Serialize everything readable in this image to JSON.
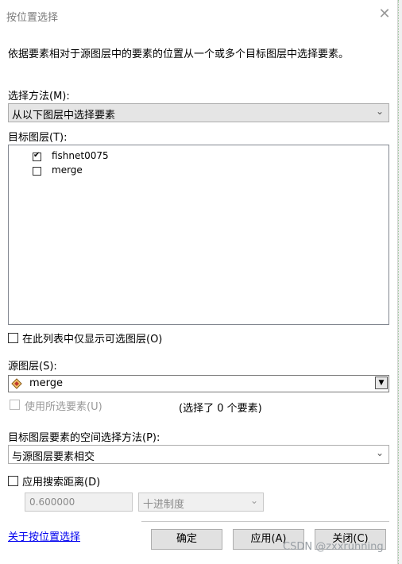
{
  "dialog": {
    "title": "按位置选择",
    "close_glyph": "✕"
  },
  "description": "依据要素相对于源图层中的要素的位置从一个或多个目标图层中选择要素。",
  "selection_method": {
    "label": "选择方法(M):",
    "value": "从以下图层中选择要素"
  },
  "target_layers": {
    "label": "目标图层(T):",
    "items": [
      {
        "name": "fishnet0075",
        "checked": true
      },
      {
        "name": "merge",
        "checked": false
      }
    ]
  },
  "only_selectable": {
    "label": "在此列表中仅显示可选图层(O)",
    "checked": false
  },
  "source_layer": {
    "label": "源图层(S):",
    "value": "merge",
    "icon": "polygon-layer-icon"
  },
  "use_selected": {
    "label": "使用所选要素(U)",
    "status": "(选择了 0 个要素)",
    "checked": false
  },
  "spatial_method": {
    "label": "目标图层要素的空间选择方法(P):",
    "value": "与源图层要素相交"
  },
  "search_distance": {
    "label": "应用搜索距离(D)",
    "checked": false,
    "value": "0.600000",
    "unit": "十进制度"
  },
  "footer": {
    "help_link": "关于按位置选择",
    "ok": "确定",
    "apply": "应用(A)",
    "close": "关闭(C)"
  },
  "watermark": "CSDN @zxxrunning",
  "colors": {
    "accent_link": "#0000ee",
    "button_bg": "#e1e1e1"
  }
}
